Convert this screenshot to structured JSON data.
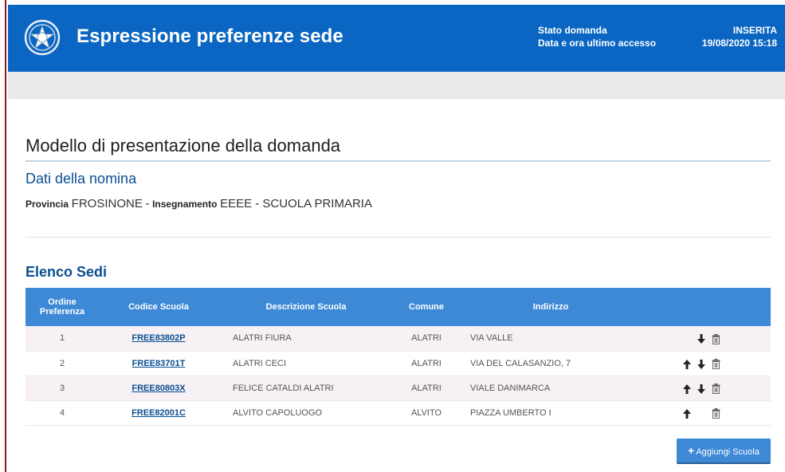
{
  "header": {
    "title": "Espressione preferenze sede",
    "status_label": "Stato domanda",
    "status_value": "INSERITA",
    "access_label": "Data e ora ultimo accesso",
    "access_value": "19/08/2020 15:18"
  },
  "page": {
    "title": "Modello di presentazione della domanda",
    "nomina_title": "Dati della nomina",
    "provincia_label": "Provincia",
    "provincia_value": "FROSINONE",
    "separator": "-",
    "insegnamento_label": "Insegnamento",
    "insegnamento_value": "EEEE - SCUOLA PRIMARIA",
    "sedi_title": "Elenco Sedi"
  },
  "table": {
    "headers": {
      "ordine_1": "Ordine",
      "ordine_2": "Preferenza",
      "codice": "Codice Scuola",
      "descrizione": "Descrizione Scuola",
      "comune": "Comune",
      "indirizzo": "Indirizzo"
    },
    "rows": [
      {
        "ordine": "1",
        "codice": "FREE83802P",
        "descrizione": "ALATRI FIURA",
        "comune": "ALATRI",
        "indirizzo": "VIA VALLE",
        "up": false,
        "down": true
      },
      {
        "ordine": "2",
        "codice": "FREE83701T",
        "descrizione": "ALATRI CECI",
        "comune": "ALATRI",
        "indirizzo": "VIA DEL CALASANZIO, 7",
        "up": true,
        "down": true
      },
      {
        "ordine": "3",
        "codice": "FREE80803X",
        "descrizione": "FELICE CATALDI ALATRI",
        "comune": "ALATRI",
        "indirizzo": "VIALE DANIMARCA",
        "up": true,
        "down": true
      },
      {
        "ordine": "4",
        "codice": "FREE82001C",
        "descrizione": "ALVITO CAPOLUOGO",
        "comune": "ALVITO",
        "indirizzo": "PIAZZA UMBERTO I",
        "up": true,
        "down": false
      }
    ]
  },
  "actions": {
    "add_label": "Aggiungi Scuola"
  },
  "colors": {
    "header_blue": "#0a66c2",
    "table_header_blue": "#3d89d6",
    "title_blue": "#0a4f91"
  },
  "icons": {
    "emblem": "italian-republic-emblem-icon",
    "up": "arrow-up-icon",
    "down": "arrow-down-icon",
    "delete": "trash-icon",
    "add": "plus-icon"
  }
}
